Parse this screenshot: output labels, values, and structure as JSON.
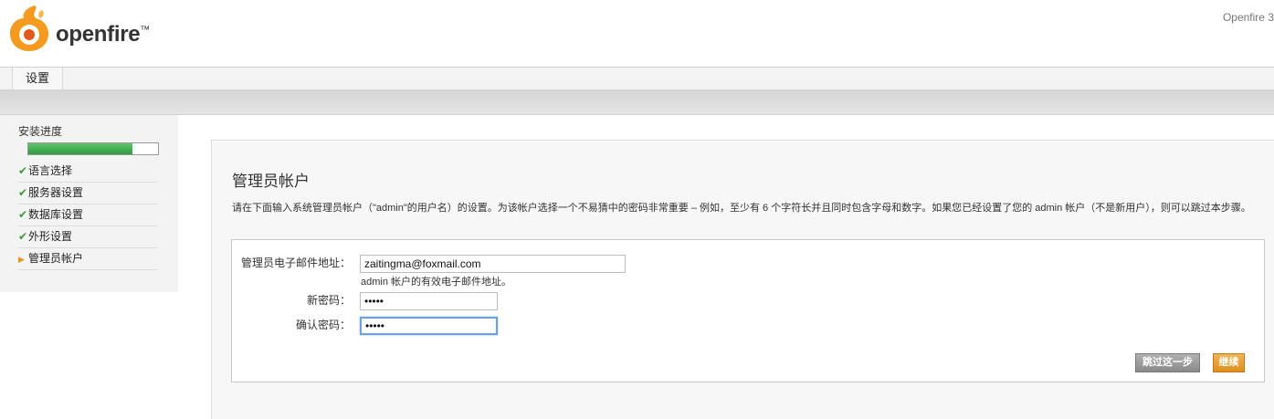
{
  "header": {
    "brand": "openfire",
    "trademark": "™",
    "version": "Openfire 3"
  },
  "tabs": [
    {
      "label": "设置"
    }
  ],
  "sidebar": {
    "progress_title": "安装进度",
    "progress_fraction": 0.8,
    "steps": [
      {
        "label": "语言选择",
        "state": "done"
      },
      {
        "label": "服务器设置",
        "state": "done"
      },
      {
        "label": "数据库设置",
        "state": "done"
      },
      {
        "label": "外形设置",
        "state": "done"
      },
      {
        "label": "管理员帐户",
        "state": "current"
      }
    ]
  },
  "main": {
    "title": "管理员帐户",
    "description": "请在下面输入系统管理员帐户（\"admin\"的用户名）的设置。为该帐户选择一个不易猜中的密码非常重要 – 例如，至少有 6 个字符长并且同时包含字母和数字。如果您已经设置了您的 admin 帐户（不是新用户），则可以跳过本步骤。",
    "form": {
      "email_label": "管理员电子邮件地址：",
      "email_value": "zaitingma@foxmail.com",
      "email_hint": "admin 帐户的有效电子邮件地址。",
      "new_password_label": "新密码：",
      "new_password_value": "•••••",
      "confirm_password_label": "确认密码：",
      "confirm_password_value": "•••••"
    },
    "buttons": {
      "skip": "跳过这一步",
      "continue": "继续"
    }
  },
  "colors": {
    "progress_green": "#2e9a3e",
    "check_green": "#3a9a35",
    "arrow_orange": "#e09a1e",
    "continue_orange": "#df8e1b",
    "skip_gray": "#8a8a8a",
    "focus_blue": "#6aa0e8"
  },
  "icons": {
    "logo": "openfire-flame-logo",
    "done": "check-icon",
    "current": "arrow-right-icon"
  }
}
